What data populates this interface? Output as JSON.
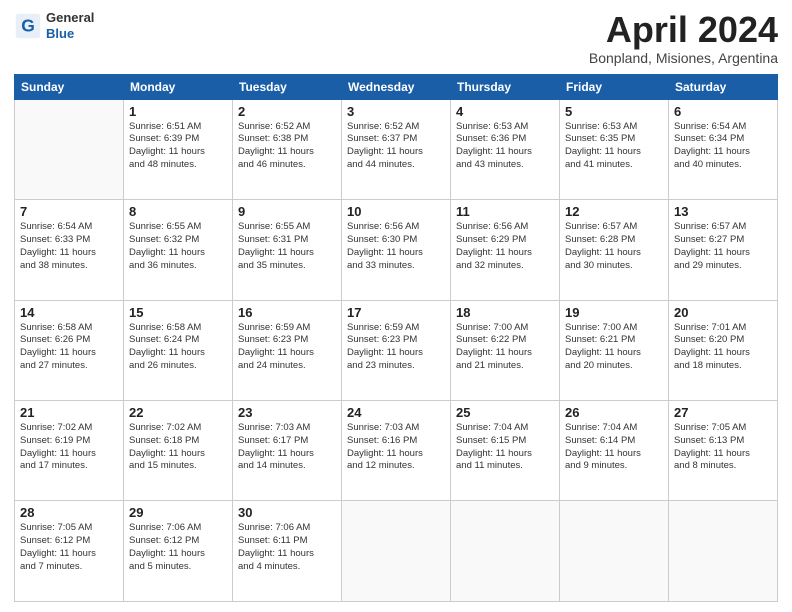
{
  "header": {
    "logo_general": "General",
    "logo_blue": "Blue",
    "month": "April 2024",
    "location": "Bonpland, Misiones, Argentina"
  },
  "weekdays": [
    "Sunday",
    "Monday",
    "Tuesday",
    "Wednesday",
    "Thursday",
    "Friday",
    "Saturday"
  ],
  "weeks": [
    [
      {
        "day": "",
        "text": ""
      },
      {
        "day": "1",
        "text": "Sunrise: 6:51 AM\nSunset: 6:39 PM\nDaylight: 11 hours\nand 48 minutes."
      },
      {
        "day": "2",
        "text": "Sunrise: 6:52 AM\nSunset: 6:38 PM\nDaylight: 11 hours\nand 46 minutes."
      },
      {
        "day": "3",
        "text": "Sunrise: 6:52 AM\nSunset: 6:37 PM\nDaylight: 11 hours\nand 44 minutes."
      },
      {
        "day": "4",
        "text": "Sunrise: 6:53 AM\nSunset: 6:36 PM\nDaylight: 11 hours\nand 43 minutes."
      },
      {
        "day": "5",
        "text": "Sunrise: 6:53 AM\nSunset: 6:35 PM\nDaylight: 11 hours\nand 41 minutes."
      },
      {
        "day": "6",
        "text": "Sunrise: 6:54 AM\nSunset: 6:34 PM\nDaylight: 11 hours\nand 40 minutes."
      }
    ],
    [
      {
        "day": "7",
        "text": "Sunrise: 6:54 AM\nSunset: 6:33 PM\nDaylight: 11 hours\nand 38 minutes."
      },
      {
        "day": "8",
        "text": "Sunrise: 6:55 AM\nSunset: 6:32 PM\nDaylight: 11 hours\nand 36 minutes."
      },
      {
        "day": "9",
        "text": "Sunrise: 6:55 AM\nSunset: 6:31 PM\nDaylight: 11 hours\nand 35 minutes."
      },
      {
        "day": "10",
        "text": "Sunrise: 6:56 AM\nSunset: 6:30 PM\nDaylight: 11 hours\nand 33 minutes."
      },
      {
        "day": "11",
        "text": "Sunrise: 6:56 AM\nSunset: 6:29 PM\nDaylight: 11 hours\nand 32 minutes."
      },
      {
        "day": "12",
        "text": "Sunrise: 6:57 AM\nSunset: 6:28 PM\nDaylight: 11 hours\nand 30 minutes."
      },
      {
        "day": "13",
        "text": "Sunrise: 6:57 AM\nSunset: 6:27 PM\nDaylight: 11 hours\nand 29 minutes."
      }
    ],
    [
      {
        "day": "14",
        "text": "Sunrise: 6:58 AM\nSunset: 6:26 PM\nDaylight: 11 hours\nand 27 minutes."
      },
      {
        "day": "15",
        "text": "Sunrise: 6:58 AM\nSunset: 6:24 PM\nDaylight: 11 hours\nand 26 minutes."
      },
      {
        "day": "16",
        "text": "Sunrise: 6:59 AM\nSunset: 6:23 PM\nDaylight: 11 hours\nand 24 minutes."
      },
      {
        "day": "17",
        "text": "Sunrise: 6:59 AM\nSunset: 6:23 PM\nDaylight: 11 hours\nand 23 minutes."
      },
      {
        "day": "18",
        "text": "Sunrise: 7:00 AM\nSunset: 6:22 PM\nDaylight: 11 hours\nand 21 minutes."
      },
      {
        "day": "19",
        "text": "Sunrise: 7:00 AM\nSunset: 6:21 PM\nDaylight: 11 hours\nand 20 minutes."
      },
      {
        "day": "20",
        "text": "Sunrise: 7:01 AM\nSunset: 6:20 PM\nDaylight: 11 hours\nand 18 minutes."
      }
    ],
    [
      {
        "day": "21",
        "text": "Sunrise: 7:02 AM\nSunset: 6:19 PM\nDaylight: 11 hours\nand 17 minutes."
      },
      {
        "day": "22",
        "text": "Sunrise: 7:02 AM\nSunset: 6:18 PM\nDaylight: 11 hours\nand 15 minutes."
      },
      {
        "day": "23",
        "text": "Sunrise: 7:03 AM\nSunset: 6:17 PM\nDaylight: 11 hours\nand 14 minutes."
      },
      {
        "day": "24",
        "text": "Sunrise: 7:03 AM\nSunset: 6:16 PM\nDaylight: 11 hours\nand 12 minutes."
      },
      {
        "day": "25",
        "text": "Sunrise: 7:04 AM\nSunset: 6:15 PM\nDaylight: 11 hours\nand 11 minutes."
      },
      {
        "day": "26",
        "text": "Sunrise: 7:04 AM\nSunset: 6:14 PM\nDaylight: 11 hours\nand 9 minutes."
      },
      {
        "day": "27",
        "text": "Sunrise: 7:05 AM\nSunset: 6:13 PM\nDaylight: 11 hours\nand 8 minutes."
      }
    ],
    [
      {
        "day": "28",
        "text": "Sunrise: 7:05 AM\nSunset: 6:12 PM\nDaylight: 11 hours\nand 7 minutes."
      },
      {
        "day": "29",
        "text": "Sunrise: 7:06 AM\nSunset: 6:12 PM\nDaylight: 11 hours\nand 5 minutes."
      },
      {
        "day": "30",
        "text": "Sunrise: 7:06 AM\nSunset: 6:11 PM\nDaylight: 11 hours\nand 4 minutes."
      },
      {
        "day": "",
        "text": ""
      },
      {
        "day": "",
        "text": ""
      },
      {
        "day": "",
        "text": ""
      },
      {
        "day": "",
        "text": ""
      }
    ]
  ]
}
